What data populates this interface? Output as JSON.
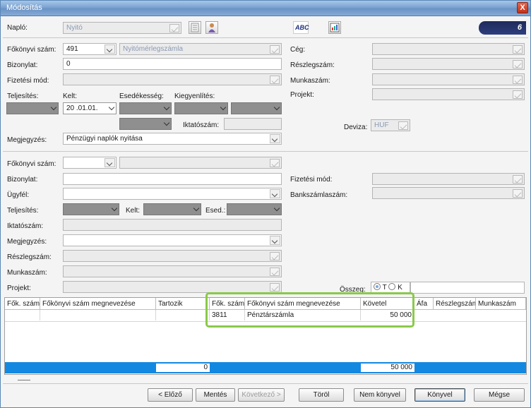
{
  "window": {
    "title": "Módosítás",
    "close": "X"
  },
  "header": {
    "naplo_label": "Napló:",
    "naplo_value": "Nyitó",
    "abc_label": "ABC",
    "counter": "6"
  },
  "top": {
    "fokonyvi_label": "Főkönyvi szám:",
    "fokonyvi_value": "491",
    "fokonyvi_name": "Nyitómérlegszámla",
    "bizonylat_label": "Bizonylat:",
    "bizonylat_value": "0",
    "fizetesi_label": "Fizetési mód:",
    "teljesites_label": "Teljesítés:",
    "kelt_label": "Kelt:",
    "esedekesseg_label": "Esedékesség:",
    "kiegyenlites_label": "Kiegyenlítés:",
    "kelt_value": "20  .01.01.",
    "iktatoszam_label": "Iktatószám:",
    "megjegyzes_label": "Megjegyzés:",
    "megjegyzes_value": "Pénzügyi naplók nyitása",
    "ceg_label": "Cég:",
    "reszlegszam_label": "Részlegszám:",
    "munkaszam_label": "Munkaszám:",
    "projekt_label": "Projekt:",
    "deviza_label": "Deviza:",
    "deviza_value": "HUF"
  },
  "bottom": {
    "fokonyvi_label": "Főkönyvi szám:",
    "bizonylat_label": "Bizonylat:",
    "ugyfel_label": "Ügyfél:",
    "teljesites_label": "Teljesítés:",
    "kelt_label": "Kelt:",
    "esed_label": "Esed.:",
    "iktatoszam_label": "Iktatószám:",
    "megjegyzes_label": "Megjegyzés:",
    "reszlegszam_label": "Részlegszám:",
    "munkaszam_label": "Munkaszám:",
    "projekt_label": "Projekt:",
    "fizetesi_label": "Fizetési mód:",
    "bankszamla_label": "Bankszámlaszám:",
    "osszeg_label": "Összeg:",
    "radio_t": "T",
    "radio_k": "K"
  },
  "grid": {
    "headers": [
      "Fők. szám",
      "Főkönyvi szám megnevezése",
      "Tartozik",
      "Fők. szám",
      "Főkönyvi szám megnevezése",
      "Követel",
      "Áfa",
      "Részlegszám",
      "Munkaszám"
    ],
    "rows": [
      {
        "fok2": "3811",
        "name2": "Pénztárszámla",
        "kovetel": "50 000"
      }
    ],
    "total_tartozik": "0",
    "total_kovetel": "50 000"
  },
  "buttons": {
    "elozo": "< Előző",
    "mentes": "Mentés",
    "kovetkezo": "Következő >",
    "torol": "Töröl",
    "nem_konyvel": "Nem könyvel",
    "konyvel": "Könyvel",
    "megse": "Mégse"
  }
}
